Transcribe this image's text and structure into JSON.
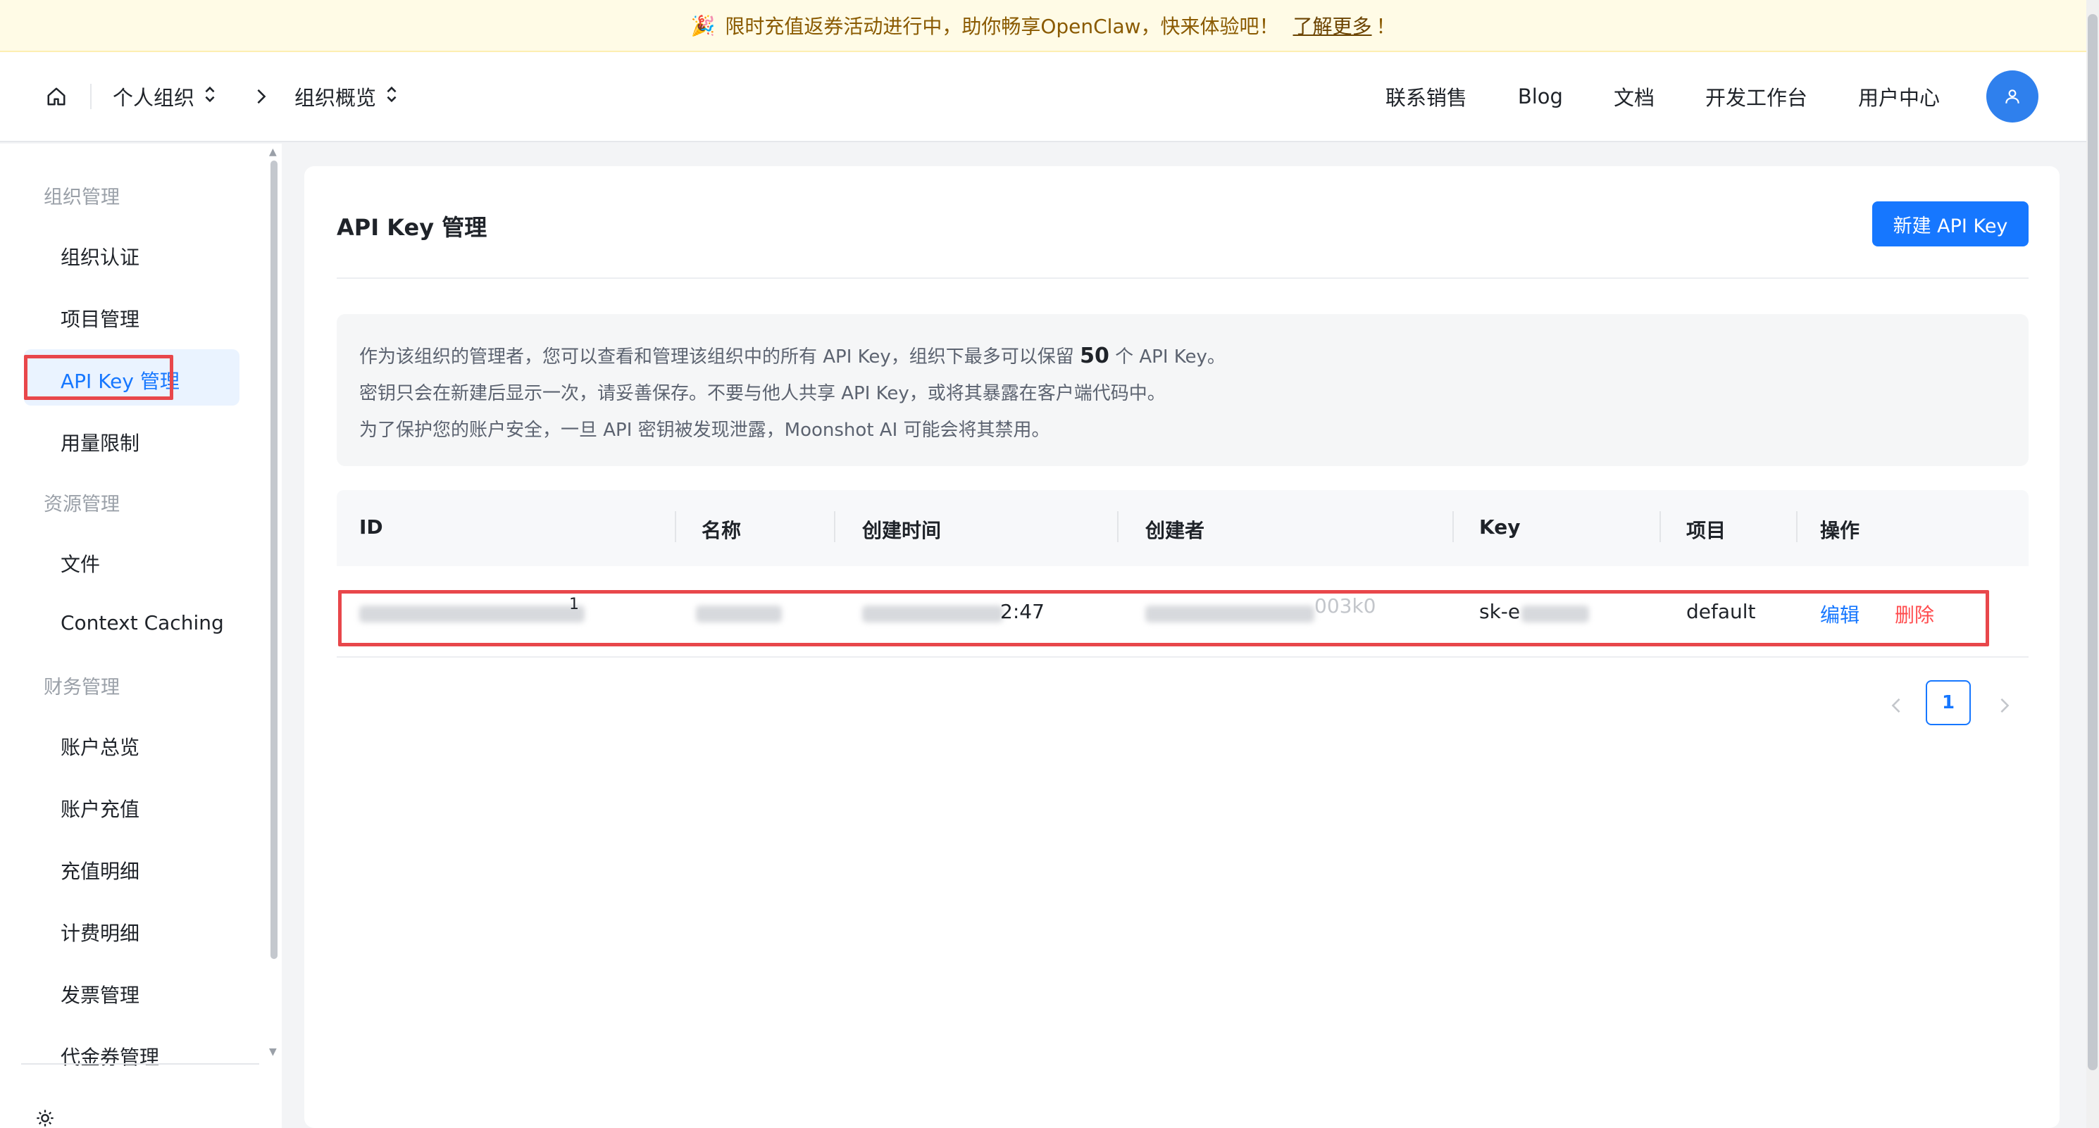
{
  "banner": {
    "text": "限时充值返券活动进行中，助你畅享OpenClaw，快来体验吧！",
    "link": "了解更多",
    "suffix": "！",
    "icon": "party-popper-icon"
  },
  "header": {
    "org_selector": "个人组织",
    "page_selector": "组织概览",
    "nav": [
      "联系销售",
      "Blog",
      "文档",
      "开发工作台",
      "用户中心"
    ],
    "avatar_icon": "user-icon"
  },
  "sidebar": {
    "groups": [
      {
        "label": "组织管理",
        "items": [
          "组织认证",
          "项目管理",
          "API Key 管理",
          "用量限制"
        ]
      },
      {
        "label": "资源管理",
        "items": [
          "文件",
          "Context Caching"
        ]
      },
      {
        "label": "财务管理",
        "items": [
          "账户总览",
          "账户充值",
          "充值明细",
          "计费明细",
          "发票管理",
          "代金券管理"
        ]
      }
    ],
    "active_item": "API Key 管理"
  },
  "main": {
    "title": "API Key 管理",
    "new_button": "新建 API Key",
    "notice": {
      "line1_before": "作为该组织的管理者，您可以查看和管理该组织中的所有 API Key，组织下最多可以保留",
      "line1_number": "50",
      "line1_after": "个 API Key。",
      "line2": "密钥只会在新建后显示一次，请妥善保存。不要与他人共享 API Key，或将其暴露在客户端代码中。",
      "line3": "为了保护您的账户安全，一旦 API 密钥被发现泄露，Moonshot AI 可能会将其禁用。"
    },
    "table": {
      "columns": [
        "ID",
        "名称",
        "创建时间",
        "创建者",
        "Key",
        "项目",
        "操作"
      ],
      "rows": [
        {
          "id_visible": "1",
          "created_visible": "2:47",
          "creator_visible": "003k0",
          "key_visible": "sk-e",
          "project": "default",
          "edit": "编辑",
          "delete": "删除"
        }
      ]
    },
    "pagination": {
      "current": "1"
    }
  },
  "colors": {
    "primary": "#1677ff",
    "danger": "#ff4d4f",
    "annotation": "#e8474b",
    "banner_bg": "#fffbe6"
  }
}
